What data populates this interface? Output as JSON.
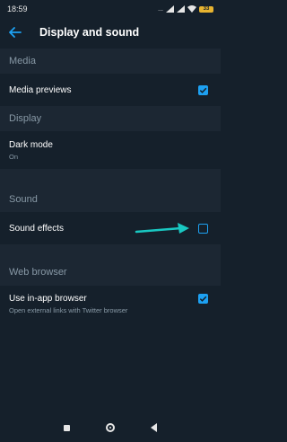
{
  "status_bar": {
    "time": "18:59",
    "signal_text": "...",
    "battery": "33"
  },
  "app_bar": {
    "title": "Display and sound"
  },
  "sections": {
    "media": {
      "header": "Media",
      "media_previews": {
        "label": "Media previews",
        "checked": true
      }
    },
    "display": {
      "header": "Display",
      "dark_mode": {
        "label": "Dark mode",
        "value": "On"
      }
    },
    "sound": {
      "header": "Sound",
      "sound_effects": {
        "label": "Sound effects",
        "checked": false
      }
    },
    "web_browser": {
      "header": "Web browser",
      "in_app_browser": {
        "label": "Use in-app browser",
        "description": "Open external links with Twitter browser",
        "checked": true
      }
    }
  },
  "colors": {
    "background": "#15202b",
    "section_background": "#1c2733",
    "accent": "#1da1f2",
    "annotation_arrow": "#19c8c2"
  },
  "icons": {
    "back": "arrow-left-icon",
    "nav_recents": "square-icon",
    "nav_home": "circle-icon",
    "nav_back": "triangle-icon"
  }
}
